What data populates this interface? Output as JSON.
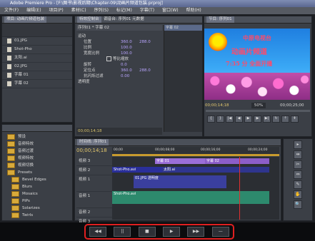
{
  "window": {
    "title": "Adobe Premiere Pro - [F:\\图书\\影视后期\\Chapter-09\\动画片频道包装.prproj]"
  },
  "menu": [
    "文件(F)",
    "编辑(E)",
    "项目(P)",
    "素材(C)",
    "序列(S)",
    "标记(M)",
    "字幕(T)",
    "窗口(W)",
    "帮助(H)"
  ],
  "project_panel": {
    "tab": "项目: 动画片频道包装",
    "files": [
      {
        "name": "01.JPG"
      },
      {
        "name": "Shot-Pho"
      },
      {
        "name": "太阳.ai"
      },
      {
        "name": "02.JPG"
      },
      {
        "name": "字幕 01"
      },
      {
        "name": "字幕 02"
      }
    ]
  },
  "effects_panel": {
    "folders": [
      "预设",
      "音频特效",
      "音频过渡",
      "视频特效",
      "视频切换"
    ],
    "folders2": [
      "Presets",
      "Bevel Edges",
      "Blurs",
      "Mosaics",
      "PiPs",
      "Solarizes",
      "Twirls"
    ]
  },
  "effect_controls": {
    "tabs": [
      "特效控制台",
      "调音台: 序列01",
      "元数据"
    ],
    "clip_label": "序列01 * 字幕 02",
    "seq_label": "字幕 02",
    "properties": [
      {
        "name": "运动",
        "v1": "",
        "v2": ""
      },
      {
        "name": "位置",
        "v1": "360.0",
        "v2": "288.0"
      },
      {
        "name": "比例",
        "v1": "100.0",
        "v2": ""
      },
      {
        "name": "宽度比例",
        "v1": "100.0",
        "v2": ""
      },
      {
        "name": "等比缩放",
        "v1": "",
        "v2": ""
      },
      {
        "name": "旋转",
        "v1": "0.0",
        "v2": ""
      },
      {
        "name": "定位点",
        "v1": "360.0",
        "v2": "288.0"
      },
      {
        "name": "抗闪烁过滤",
        "v1": "0.00",
        "v2": ""
      },
      {
        "name": "透明度",
        "v1": "",
        "v2": ""
      }
    ],
    "current_time": "00;00;14;18"
  },
  "program_monitor": {
    "tab": "节目: 序列01",
    "text_line1": "中原电视台",
    "text_line2": "动画片频道",
    "text_line3": "7:35 分 全面开播",
    "timecode": "00;00;14;18",
    "zoom": "50%",
    "duration": "00;00;25;00"
  },
  "timeline": {
    "tab": "时间线: 序列01",
    "timecode": "00;00;14;18",
    "ruler": [
      "00;00",
      "00;00;08;00",
      "00;00;16;00",
      "00;00;24;00"
    ],
    "tracks": [
      {
        "name": "视频 3"
      },
      {
        "name": "视频 2"
      },
      {
        "name": "视频 1"
      },
      {
        "name": "音频 1"
      },
      {
        "name": "音频 2"
      },
      {
        "name": "音频 3"
      }
    ],
    "clips": {
      "v3_a": "字幕 01",
      "v3_b": "字幕 02",
      "v2_a": "Shot-Pho.avi",
      "v2_b": "太阳.ai",
      "v1_a": "01.JPG 透明度",
      "a1": "Shot-Pho.avi"
    }
  },
  "tools": [
    "▸",
    "⇹",
    "✂",
    "⇔",
    "✎",
    "✋",
    "🔍"
  ],
  "transport": {
    "buttons": [
      "◀◀",
      "||",
      "■",
      "▶",
      "▶▶",
      "—"
    ]
  },
  "colors": {
    "highlight_border": "#e02020",
    "v3_clip": "#9b6fd8",
    "v2_clip": "#2a2f9a",
    "audio_clip": "#2d8a6d"
  }
}
